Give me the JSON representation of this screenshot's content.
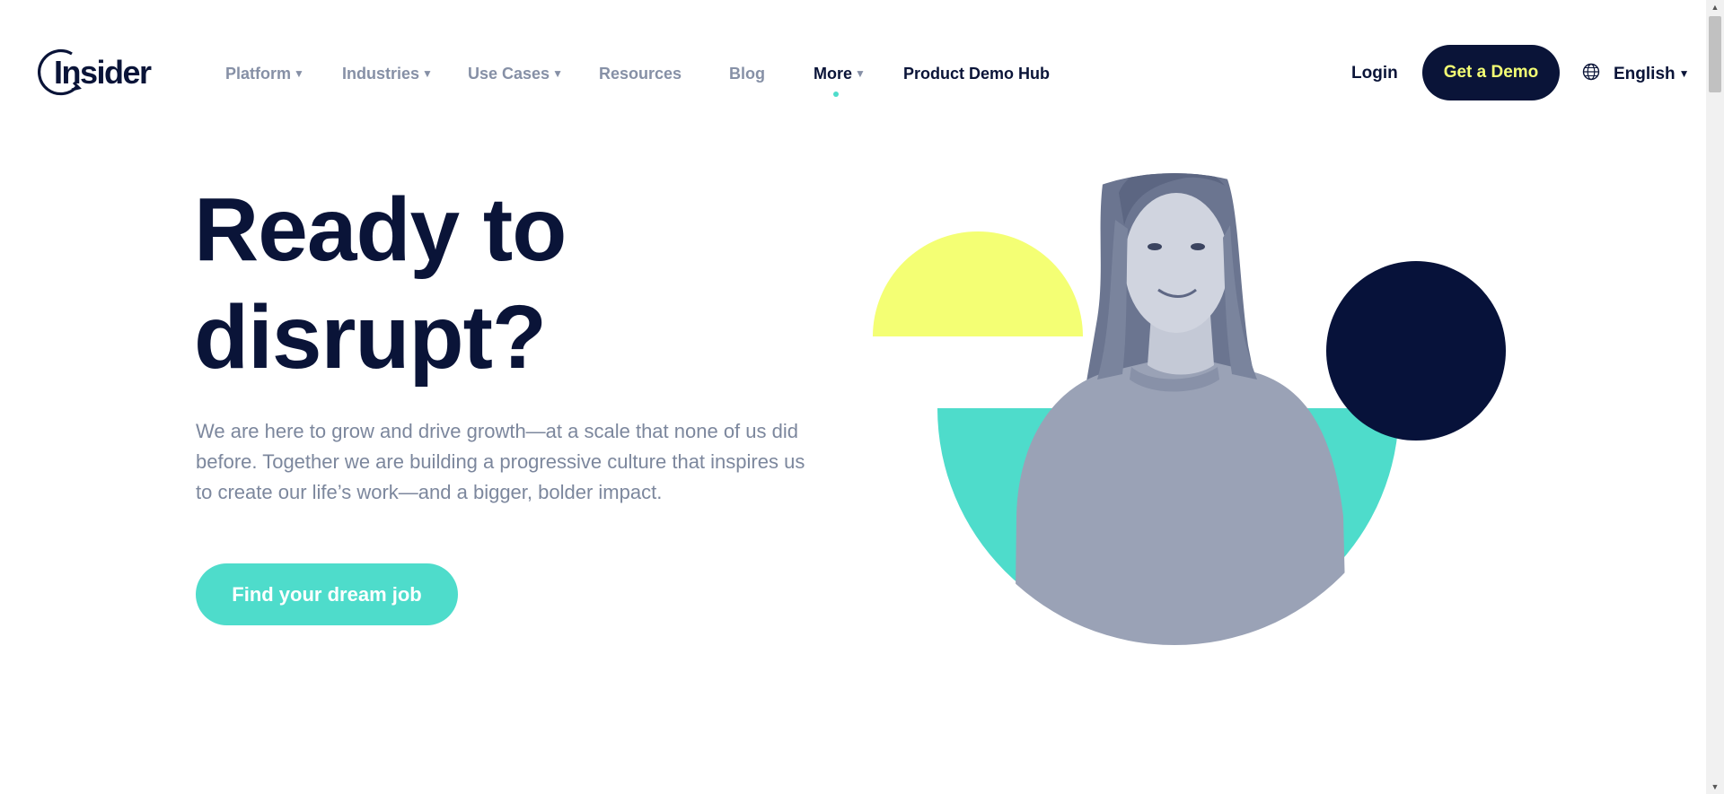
{
  "brand": {
    "logo_text": "Insider"
  },
  "nav": {
    "items": [
      {
        "label": "Platform",
        "caret": "▼"
      },
      {
        "label": "Industries",
        "caret": "▼"
      },
      {
        "label": "Use Cases",
        "caret": "▼"
      },
      {
        "label": "Resources"
      },
      {
        "label": "Blog"
      },
      {
        "label": "More",
        "caret": "▼"
      },
      {
        "label": "Product Demo Hub"
      }
    ]
  },
  "header": {
    "login_label": "Login",
    "demo_label": "Get a Demo",
    "language": "English",
    "language_caret": "▼"
  },
  "hero": {
    "title_line1": "Ready to",
    "title_line2": "disrupt?",
    "description": "We are here to grow and drive growth—at a scale that none of us did before. Together we are building a progressive culture that inspires us to create our life’s work—and a bigger, bolder impact.",
    "cta_label": "Find your dream job"
  },
  "colors": {
    "navy": "#0a1438",
    "teal": "#4edccb",
    "yellow": "#f4ff74",
    "muted": "#7c879d"
  },
  "icons": [
    "insider-logo-icon",
    "globe-icon",
    "caret-down-icon"
  ]
}
